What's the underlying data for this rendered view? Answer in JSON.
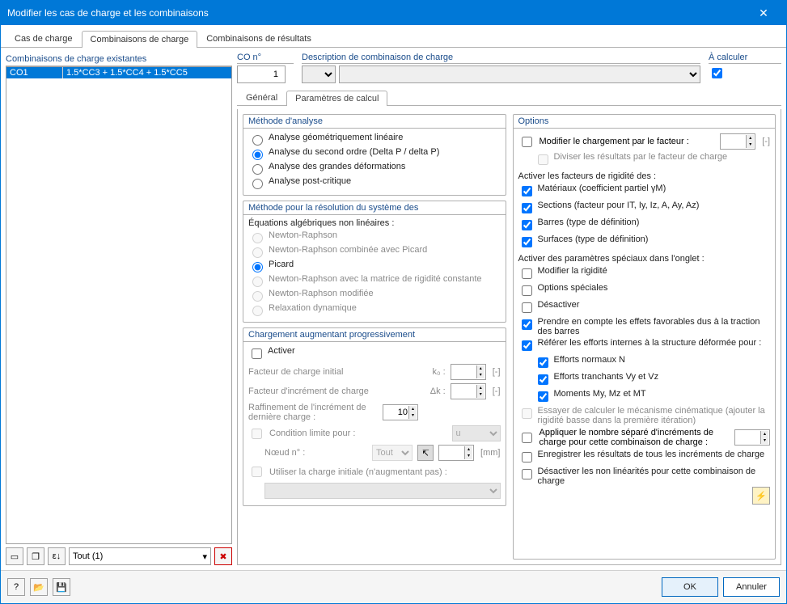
{
  "window": {
    "title": "Modifier les cas de charge et les combinaisons"
  },
  "main_tabs": {
    "t1": "Cas de charge",
    "t2": "Combinaisons de charge",
    "t3": "Combinaisons de résultats"
  },
  "left": {
    "header": "Combinaisons de charge existantes",
    "rows": [
      {
        "id": "CO1",
        "desc": "1.5*CC3 + 1.5*CC4 + 1.5*CC5"
      }
    ],
    "filter": "Tout (1)"
  },
  "top": {
    "co_label": "CO n°",
    "co_value": "1",
    "desc_label": "Description de combinaison de charge",
    "calc_label": "À calculer",
    "calc_checked": true
  },
  "subtabs": {
    "t1": "Général",
    "t2": "Paramètres de calcul"
  },
  "method": {
    "header": "Méthode d'analyse",
    "o1": "Analyse géométriquement linéaire",
    "o2": "Analyse du second ordre (Delta P / delta P)",
    "o3": "Analyse des grandes déformations",
    "o4": "Analyse post-critique"
  },
  "solver": {
    "header": "Méthode pour la résolution du système des",
    "sub": "Équations algébriques non linéaires :",
    "o1": "Newton-Raphson",
    "o2": "Newton-Raphson combinée avec Picard",
    "o3": "Picard",
    "o4": "Newton-Raphson avec la matrice de rigidité constante",
    "o5": "Newton-Raphson modifiée",
    "o6": "Relaxation dynamique"
  },
  "incr": {
    "header": "Chargement augmentant progressivement",
    "activate": "Activer",
    "f_init": "Facteur de charge initial",
    "f_init_sym": "k₀ :",
    "f_inc": "Facteur d'incrément de charge",
    "f_inc_sym": "Δk :",
    "ref": "Raffinement de l'incrément de dernière charge :",
    "ref_val": "10",
    "cond": "Condition limite pour :",
    "cond_val": "u",
    "node": "Nœud n° :",
    "node_val": "Tout",
    "unit_mm": "[mm]",
    "use_init": "Utiliser la charge initiale (n'augmentant pas) :"
  },
  "opts": {
    "header": "Options",
    "mod_fact": "Modifier le chargement par le facteur :",
    "div": "Diviser les résultats par le facteur de charge",
    "stiff_h": "Activer les facteurs de rigidité des :",
    "mat": "Matériaux (coefficient partiel γM)",
    "sec": "Sections (facteur pour IT, Iy, Iz, A, Ay, Az)",
    "bar": "Barres (type de définition)",
    "surf": "Surfaces (type de définition)",
    "spec_h": "Activer des paramètres spéciaux dans l'onglet :",
    "mod_rig": "Modifier la rigidité",
    "opt_spec": "Options spéciales",
    "deact": "Désactiver",
    "fav": "Prendre en compte les effets favorables dus à la traction des barres",
    "ref_eff": "Référer les efforts internes à la structure déformée pour :",
    "eff_n": "Efforts normaux N",
    "eff_v": "Efforts tranchants Vy et Vz",
    "eff_m": "Moments My, Mz et MT",
    "kin": "Essayer de calculer le mécanisme cinématique (ajouter la rigidité basse dans la première itération)",
    "sep": "Appliquer le nombre séparé d'incréments de charge pour cette combinaison de charge :",
    "rec": "Enregistrer les résultats de tous les incréments de charge",
    "deact_nl": "Désactiver les non linéarités pour cette combinaison de charge"
  },
  "footer": {
    "ok": "OK",
    "cancel": "Annuler"
  },
  "unit_dash": "[-]"
}
